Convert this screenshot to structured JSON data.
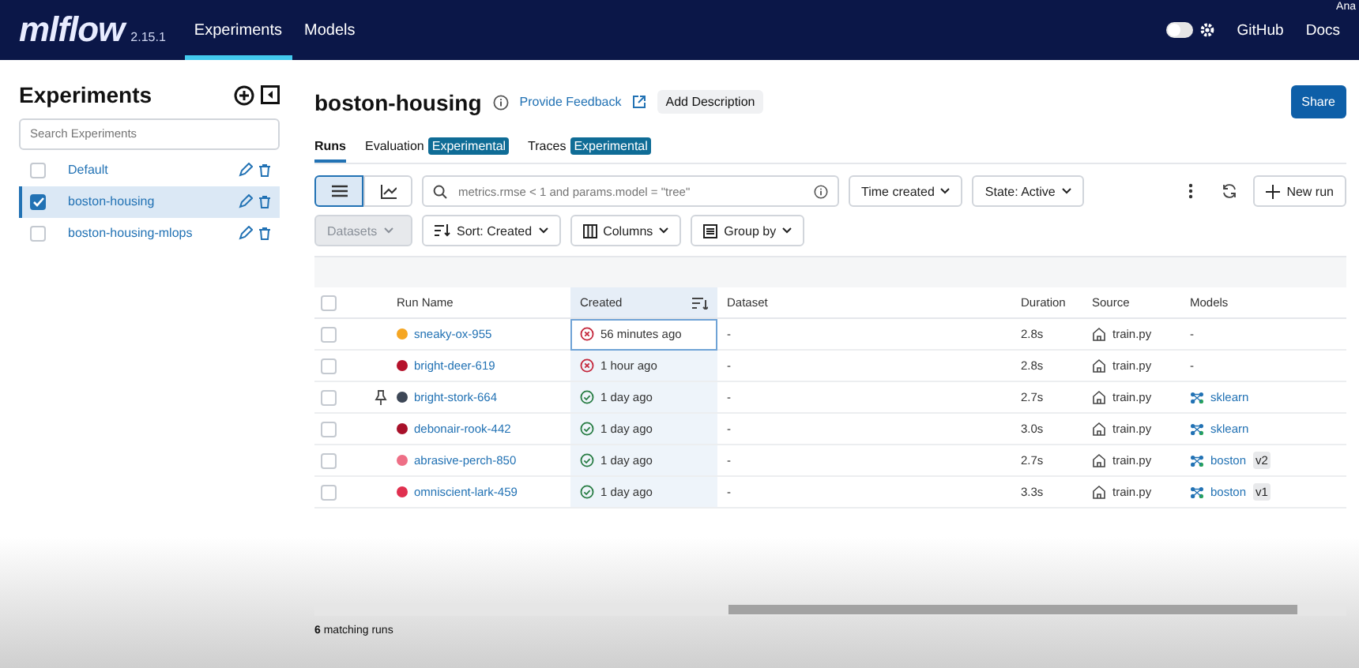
{
  "header": {
    "logo": "mlflow",
    "version": "2.15.1",
    "nav": [
      {
        "label": "Experiments",
        "selected": true
      },
      {
        "label": "Models",
        "selected": false
      }
    ],
    "theme_toggle": {
      "on": false
    },
    "links": [
      "GitHub",
      "Docs"
    ],
    "user": "Ana"
  },
  "sidebar": {
    "title": "Experiments",
    "search": {
      "placeholder": "Search Experiments"
    },
    "items": [
      {
        "name": "Default",
        "selected": false
      },
      {
        "name": "boston-housing",
        "selected": true
      },
      {
        "name": "boston-housing-mlops",
        "selected": false
      }
    ]
  },
  "experiment": {
    "title": "boston-housing",
    "feedback": "Provide Feedback",
    "add_description": "Add Description",
    "share": "Share"
  },
  "tabs": [
    {
      "label": "Runs",
      "selected": true
    },
    {
      "label": "Evaluation",
      "badge": "Experimental",
      "selected": false
    },
    {
      "label": "Traces",
      "badge": "Experimental",
      "selected": false
    }
  ],
  "toolbar": {
    "views": [
      {
        "kind": "table",
        "selected": true
      },
      {
        "kind": "chart",
        "selected": false
      }
    ],
    "search": {
      "placeholder": "metrics.rmse < 1 and params.model = \"tree\""
    },
    "sort_by": "Time created",
    "state": "State: Active",
    "new_run": "New run",
    "datasets": {
      "label": "Datasets",
      "disabled": true
    },
    "sort": "Sort: Created",
    "columns": "Columns",
    "group_by": "Group by"
  },
  "table": {
    "select_all_checked": false,
    "columns": [
      "Run Name",
      "Created",
      "Dataset",
      "Duration",
      "Source",
      "Models"
    ],
    "rows": [
      {
        "checked": false,
        "pinned": false,
        "name": "sneaky-ox-955",
        "color": "#f5a623",
        "failed": true,
        "created": "56 minutes ago",
        "focused": true,
        "dataset": "-",
        "duration": "2.8s",
        "source": "train.py",
        "model": {
          "kind": "none",
          "text": "-"
        }
      },
      {
        "checked": false,
        "pinned": false,
        "name": "bright-deer-619",
        "color": "#b5122b",
        "failed": true,
        "created": "1 hour ago",
        "focused": false,
        "dataset": "-",
        "duration": "2.8s",
        "source": "train.py",
        "model": {
          "kind": "none",
          "text": "-"
        }
      },
      {
        "checked": false,
        "pinned": true,
        "name": "bright-stork-664",
        "color": "#3d4756",
        "failed": false,
        "created": "1 day ago",
        "focused": false,
        "dataset": "-",
        "duration": "2.7s",
        "source": "train.py",
        "model": {
          "kind": "logged",
          "text": "sklearn"
        }
      },
      {
        "checked": false,
        "pinned": false,
        "name": "debonair-rook-442",
        "color": "#a8112a",
        "failed": false,
        "created": "1 day ago",
        "focused": false,
        "dataset": "-",
        "duration": "3.0s",
        "source": "train.py",
        "model": {
          "kind": "logged",
          "text": "sklearn"
        }
      },
      {
        "checked": false,
        "pinned": false,
        "name": "abrasive-perch-850",
        "color": "#ee6f86",
        "failed": false,
        "created": "1 day ago",
        "focused": false,
        "dataset": "-",
        "duration": "2.7s",
        "source": "train.py",
        "model": {
          "kind": "registered",
          "text": "boston",
          "version": "v2"
        }
      },
      {
        "checked": false,
        "pinned": false,
        "name": "omniscient-lark-459",
        "color": "#e0304f",
        "failed": false,
        "created": "1 day ago",
        "focused": false,
        "dataset": "-",
        "duration": "3.3s",
        "source": "train.py",
        "model": {
          "kind": "registered",
          "text": "boston",
          "version": "v1"
        }
      }
    ]
  },
  "footer": {
    "count": "**6** matching runs"
  }
}
